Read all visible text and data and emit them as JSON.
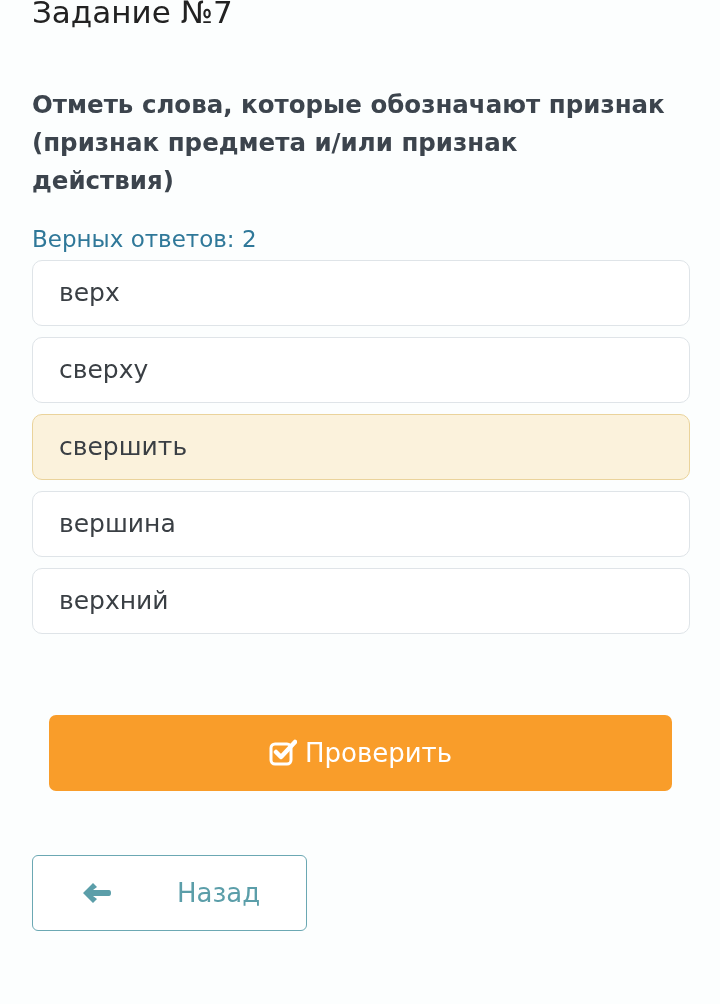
{
  "task_title": "Задание №7",
  "question": "Отметь слова, которые обозначают признак (признак предмета и/или признак действия)",
  "answers_hint": "Верных ответов: 2",
  "options": [
    {
      "label": "верх",
      "selected": false
    },
    {
      "label": "сверху",
      "selected": false
    },
    {
      "label": "свершить",
      "selected": true
    },
    {
      "label": "вершина",
      "selected": false
    },
    {
      "label": "верхний",
      "selected": false
    }
  ],
  "check_button": {
    "label": "Проверить"
  },
  "back_button": {
    "label": "Назад"
  }
}
